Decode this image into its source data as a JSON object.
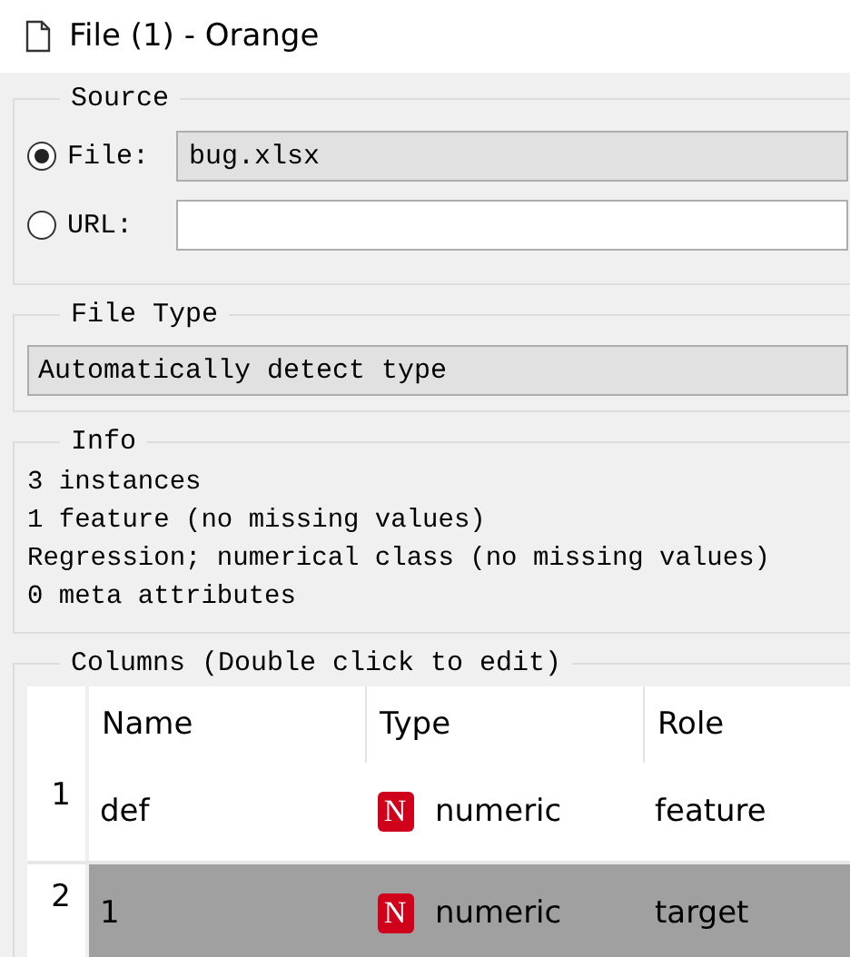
{
  "window": {
    "title": "File (1) - Orange"
  },
  "source": {
    "title": "Source",
    "options": [
      {
        "label": "File:",
        "selected": true,
        "kind": "combo",
        "value": "bug.xlsx"
      },
      {
        "label": "URL:",
        "selected": false,
        "kind": "input"
      }
    ]
  },
  "file_type": {
    "title": "File Type",
    "value": "Automatically detect type"
  },
  "info": {
    "title": "Info",
    "lines": [
      "3 instances",
      "1 feature (no missing values)",
      "Regression; numerical class (no missing values)",
      "0 meta attributes"
    ]
  },
  "columns": {
    "title": "Columns (Double click to edit)",
    "headers": [
      "Name",
      "Type",
      "Role"
    ],
    "rows": [
      {
        "index": "1",
        "name": "def",
        "type_badge": "N",
        "type": "numeric",
        "role": "feature",
        "selected": false
      },
      {
        "index": "2",
        "name": "1",
        "type_badge": "N",
        "type": "numeric",
        "role": "target",
        "selected": true
      }
    ]
  }
}
